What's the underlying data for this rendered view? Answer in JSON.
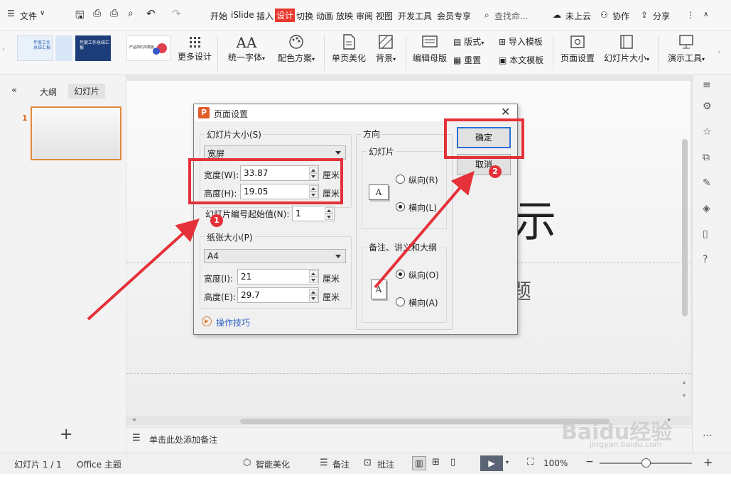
{
  "menubar": {
    "file": "文件",
    "tabs": [
      "开始",
      "iSlide",
      "插入",
      "设计",
      "切换",
      "动画",
      "放映",
      "审阅",
      "视图",
      "开发工具",
      "会员专享"
    ],
    "active_tab": "设计",
    "search": "查找命...",
    "cloud": "未上云",
    "collab": "协作",
    "share": "分享"
  },
  "ribbon": {
    "more_design": "更多设计",
    "unify_font": "统一字体",
    "color_scheme": "配色方案",
    "page_beautify": "单页美化",
    "background": "背景",
    "edit_master": "编辑母版",
    "layout": "版式",
    "reset": "重置",
    "import_template": "导入模板",
    "text_template": "本文模板",
    "page_setup": "页面设置",
    "slide_size": "幻灯片大小",
    "present_tools": "演示工具",
    "thumb_texts": [
      "年度工作总结汇报",
      "年度工作总结汇报",
      "产品简约风模板"
    ]
  },
  "leftpanel": {
    "outline_tab": "大纲",
    "slides_tab": "幻灯片",
    "slide_number": "1",
    "add_symbol": "+"
  },
  "slide": {
    "partial_title": "示",
    "partial_subtitle": "题"
  },
  "notes": {
    "placeholder": "单击此处添加备注"
  },
  "statusbar": {
    "slide_count": "幻灯片 1 / 1",
    "theme": "Office 主题",
    "smart_beautify": "智能美化",
    "notes": "备注",
    "comment": "批注",
    "zoom": "100%"
  },
  "dialog": {
    "title": "页面设置",
    "slide_size_label": "幻灯片大小(S)",
    "slide_size_value": "宽屏",
    "width_label": "宽度(W):",
    "width_value": "33.87",
    "height_label": "高度(H):",
    "height_value": "19.05",
    "unit": "厘米",
    "start_number_label": "幻灯片编号起始值(N):",
    "start_number_value": "1",
    "paper_size_label": "纸张大小(P)",
    "paper_size_value": "A4",
    "paper_width_label": "宽度(I):",
    "paper_width_value": "21",
    "paper_height_label": "高度(E):",
    "paper_height_value": "29.7",
    "tips": "操作技巧",
    "orientation_label": "方向",
    "slides_group": "幻灯片",
    "portrait_r": "纵向(R)",
    "landscape_l": "横向(L)",
    "notes_group": "备注、讲义和大纲",
    "portrait_o": "纵向(O)",
    "landscape_a": "横向(A)",
    "ok": "确定",
    "cancel": "取消",
    "page_icon_letter": "A"
  },
  "annotations": {
    "badge1": "1",
    "badge2": "2",
    "color": "#e5313a"
  },
  "watermark": {
    "brand": "Baidu经验",
    "url": "jingyan.baidu.com"
  },
  "colors": {
    "accent_red": "#e8372c",
    "ok_border": "#2a6fd6"
  }
}
